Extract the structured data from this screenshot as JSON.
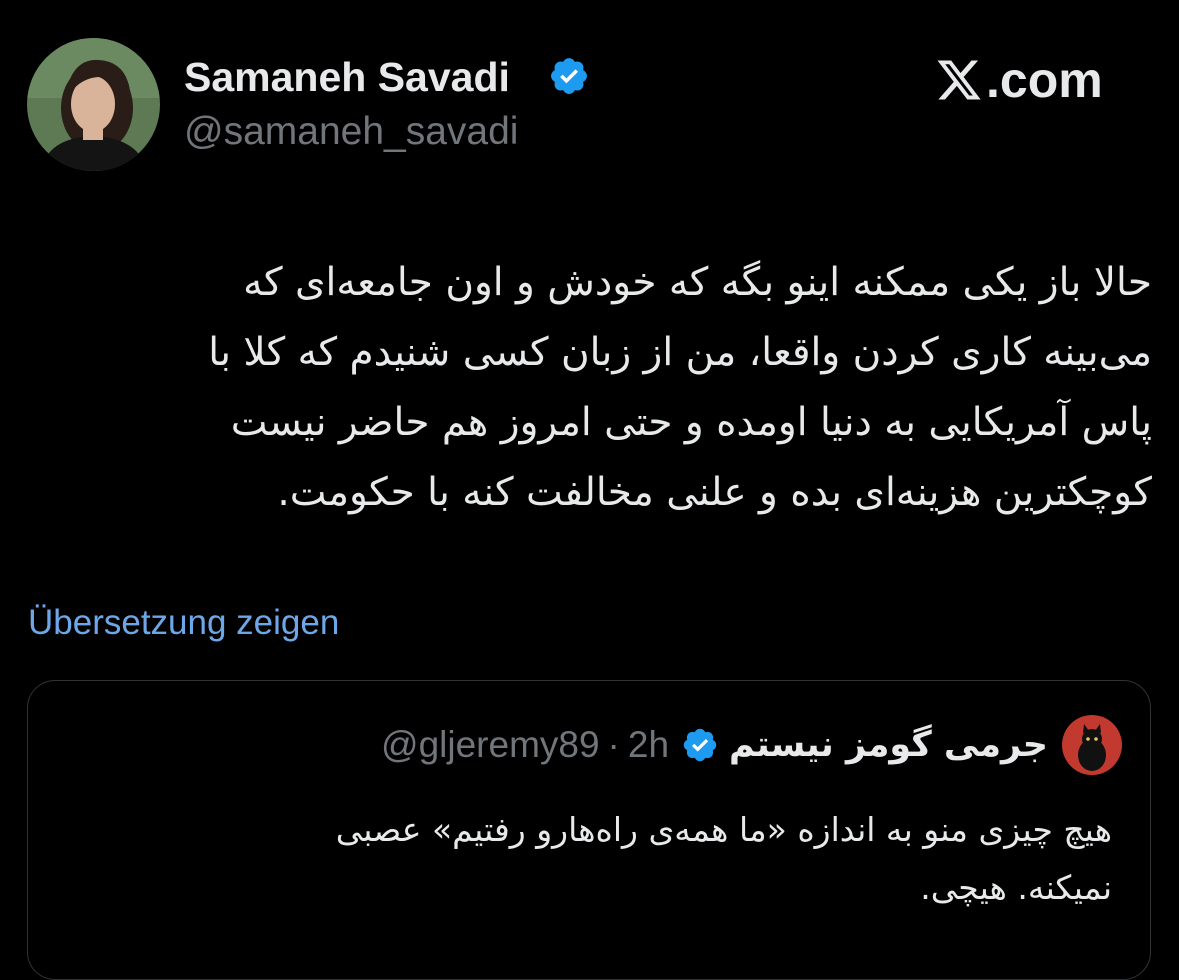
{
  "author": {
    "name": "Samaneh Savadi",
    "handle": "@samaneh_savadi",
    "verified": true,
    "avatar": "profile-photo-woman-curly-hair"
  },
  "site": {
    "logo": "x-logo-icon",
    "label": ".com"
  },
  "tweet": {
    "lines": [
      "حالا باز یکی ممکنه اینو بگه که خودش و اون جامعه‌ای که",
      "می‌بینه کاری کردن واقعا، من از زبان کسی شنیدم که کلا با",
      "پاس آمریکایی به دنیا اومده و حتی امروز هم حاضر نیست",
      "کوچکترین هزینه‌ای بده و علنی مخالفت کنه با حکومت."
    ]
  },
  "translate_link": "Übersetzung zeigen",
  "quoted_tweet": {
    "author_name": "جرمی گومز نیستم",
    "handle": "@gljeremy89",
    "separator": "·",
    "time": "2h",
    "verified": true,
    "avatar": "black-cat-on-red-avatar",
    "lines": [
      "هیچ چیزی منو به اندازه «ما همه‌ی راه‌هارو رفتیم» عصبی",
      "نمیکنه. هیچی."
    ]
  },
  "colors": {
    "background": "#000000",
    "text": "#e7e9ea",
    "secondary": "#71767b",
    "link": "#6ea7e8",
    "verified": "#1d9bf0",
    "card_border": "#2f3336"
  }
}
